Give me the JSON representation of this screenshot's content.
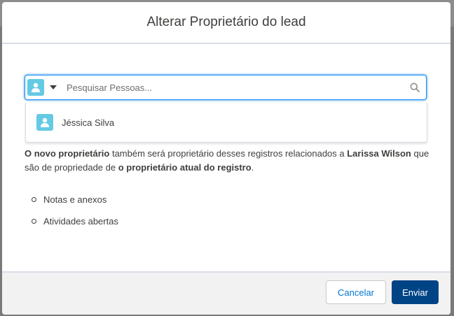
{
  "modal": {
    "title": "Alterar Proprietário do lead"
  },
  "lookup": {
    "placeholder": "Pesquisar Pessoas...",
    "entity_icon": "user-icon",
    "caret_icon": "caret-down-icon",
    "search_icon": "search-icon"
  },
  "dropdown": {
    "items": [
      {
        "label": "Jéssica Silva",
        "icon": "user-icon"
      }
    ]
  },
  "description": {
    "part1_bold": "O novo proprietário",
    "part2": " também será proprietário desses registros relacionados a ",
    "part3_bold": "Larissa Wilson",
    "part4": " que são de propriedade de ",
    "part5_bold": "o proprietário atual do registro",
    "part6": "."
  },
  "records": [
    "Notas e anexos",
    "Atividades abertas"
  ],
  "footer": {
    "cancel_label": "Cancelar",
    "send_label": "Enviar"
  },
  "colors": {
    "accent": "#0176d3",
    "primary_button": "#014486",
    "user_icon_bg": "#65cae4"
  }
}
